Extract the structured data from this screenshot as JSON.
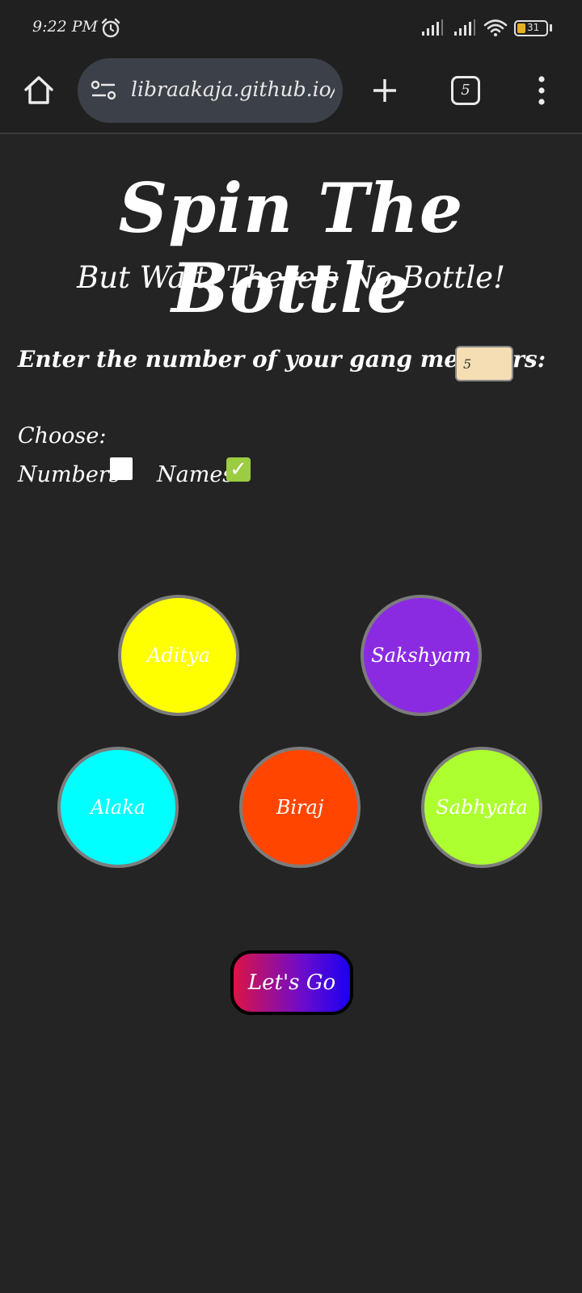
{
  "status_bar": {
    "time": "9:22 PM",
    "battery": "31",
    "icons": [
      "alarm-icon",
      "signal-icon",
      "signal-icon",
      "wifi-icon",
      "battery-icon"
    ]
  },
  "browser": {
    "url": "libraakaja.github.io/:",
    "tab_count": "5",
    "icons": [
      "home-icon",
      "site-settings-icon",
      "plus-icon",
      "more-vert-icon"
    ]
  },
  "page": {
    "title": "Spin The Bottle",
    "subtitle": "But Wait, There's No Bottle!",
    "members_label": "Enter the number of your gang members:",
    "members_value": "5",
    "choose_label": "Choose:",
    "options": [
      {
        "label": "Numbers",
        "checked": false
      },
      {
        "label": "Names",
        "checked": true
      }
    ],
    "members": [
      {
        "name": "Aditya",
        "color": "#ffff00"
      },
      {
        "name": "Sakshyam",
        "color": "#8a2be2"
      },
      {
        "name": "Alaka",
        "color": "#00ffff"
      },
      {
        "name": "Biraj",
        "color": "#ff4500"
      },
      {
        "name": "Sabhyata",
        "color": "#adff2f"
      }
    ],
    "go_button": "Let's Go"
  }
}
